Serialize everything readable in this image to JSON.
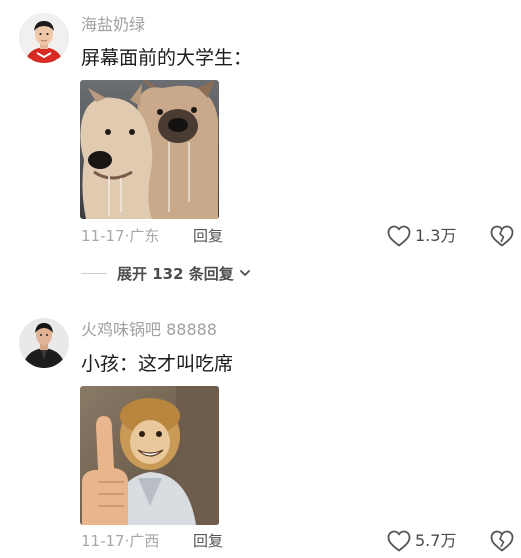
{
  "comments": [
    {
      "username": "海盐奶绿",
      "text": "屏幕面前的大学生：",
      "time": "11-17",
      "location": "广东",
      "reply_label": "回复",
      "like_count": "1.3万",
      "avatar": "avatar-racer-icon",
      "media": "drooling-dogs-image"
    },
    {
      "username": "火鸡味锅吧 88888",
      "text": "小孩：这才叫吃席",
      "time": "11-17",
      "location": "广西",
      "reply_label": "回复",
      "like_count": "5.7万",
      "avatar": "avatar-dark-jacket-icon",
      "media": "monkey-thumbs-up-image"
    }
  ],
  "expand_replies": {
    "label": "展开 132 条回复"
  },
  "colors": {
    "username": "#a1a1a1",
    "text": "#1c1c1c",
    "meta": "#a7a7a7",
    "icon": "#555555"
  },
  "separator": "·"
}
